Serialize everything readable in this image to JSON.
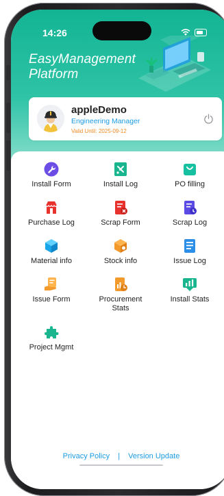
{
  "status_bar": {
    "time": "14:26"
  },
  "app": {
    "title": "EasyManagement Platform"
  },
  "user": {
    "name": "appleDemo",
    "role": "Engineering Manager",
    "valid_label": "Valid Until:",
    "valid_date": "2025-09-12"
  },
  "menu": [
    {
      "label": "Install Form",
      "icon": "wrench-icon",
      "color": "#6c4de6"
    },
    {
      "label": "Install Log",
      "icon": "tools-log-icon",
      "color": "#19b58f"
    },
    {
      "label": "PO filling",
      "icon": "shopping-bag-icon",
      "color": "#17c0a0"
    },
    {
      "label": "Purchase Log",
      "icon": "store-icon",
      "color": "#e8322e"
    },
    {
      "label": "Scrap Form",
      "icon": "scrap-form-icon",
      "color": "#e8322e"
    },
    {
      "label": "Scrap Log",
      "icon": "scrap-log-icon",
      "color": "#5b4be3"
    },
    {
      "label": "Material info",
      "icon": "cube-icon",
      "color": "#18a6e8"
    },
    {
      "label": "Stock info",
      "icon": "box-icon",
      "color": "#f39a2c"
    },
    {
      "label": "Issue Log",
      "icon": "document-icon",
      "color": "#2b8fe8"
    },
    {
      "label": "Issue Form",
      "icon": "hand-document-icon",
      "color": "#f39a2c"
    },
    {
      "label": "Procurement Stats",
      "icon": "chart-doc-icon",
      "color": "#f39a2c"
    },
    {
      "label": "Install Stats",
      "icon": "stats-icon",
      "color": "#19b58f"
    },
    {
      "label": "Project Mgmt",
      "icon": "puzzle-icon",
      "color": "#19b58f"
    }
  ],
  "footer": {
    "privacy": "Privacy Policy",
    "separator": "|",
    "version": "Version Update"
  }
}
